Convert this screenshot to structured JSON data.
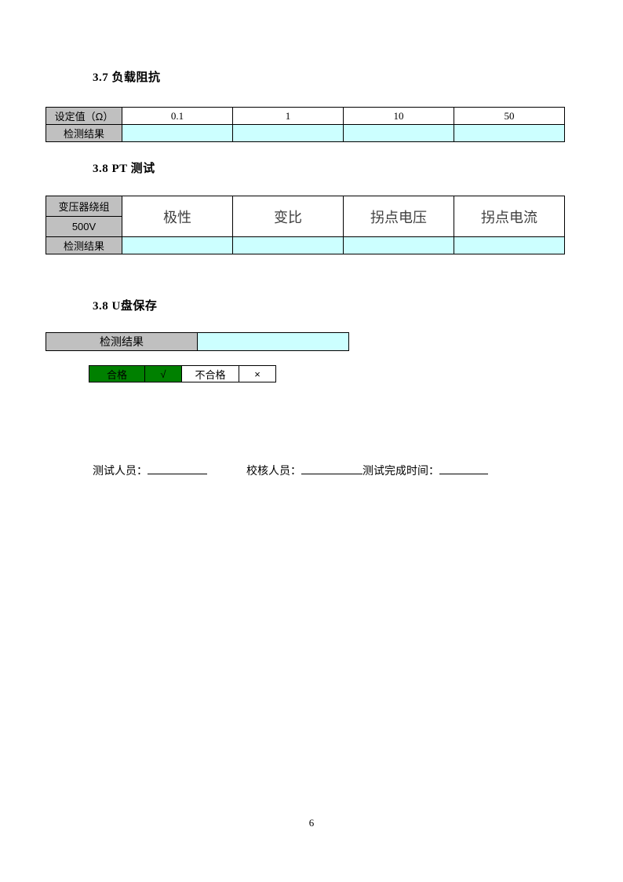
{
  "document": {
    "page_number": "6"
  },
  "sections": {
    "load_impedance": {
      "heading": "3.7 负载阻抗",
      "table": {
        "row_header_label": "设定值（Ω）",
        "result_label": "检测结果",
        "setpoints": [
          "0.1",
          "1",
          "10",
          "50"
        ],
        "results": [
          "",
          "",
          "",
          ""
        ]
      }
    },
    "pt_test": {
      "heading": "3.8 PT 测试",
      "table": {
        "winding_label_line1": "变压器绕组",
        "winding_label_line2": "500V",
        "result_label": "检测结果",
        "columns": [
          "极性",
          "变比",
          "拐点电压",
          "拐点电流"
        ],
        "results": [
          "",
          "",
          "",
          ""
        ]
      }
    },
    "usb_save": {
      "heading": "3.8 U盘保存",
      "table": {
        "result_label": "检测结果",
        "result_value": ""
      },
      "legend": {
        "pass_label": "合格",
        "pass_mark": "√",
        "fail_label": "不合格",
        "fail_mark": "×"
      }
    }
  },
  "signature": {
    "tester_label": "测试人员：",
    "checker_label": "校核人员：",
    "completion_time_label": "测试完成时间：",
    "tester_value": "",
    "checker_value": "",
    "completion_time_value": ""
  },
  "colors": {
    "fill_cyan": "#ccffff",
    "fill_gray": "#c0c0c0",
    "fill_green": "#008000",
    "border": "#000000"
  }
}
